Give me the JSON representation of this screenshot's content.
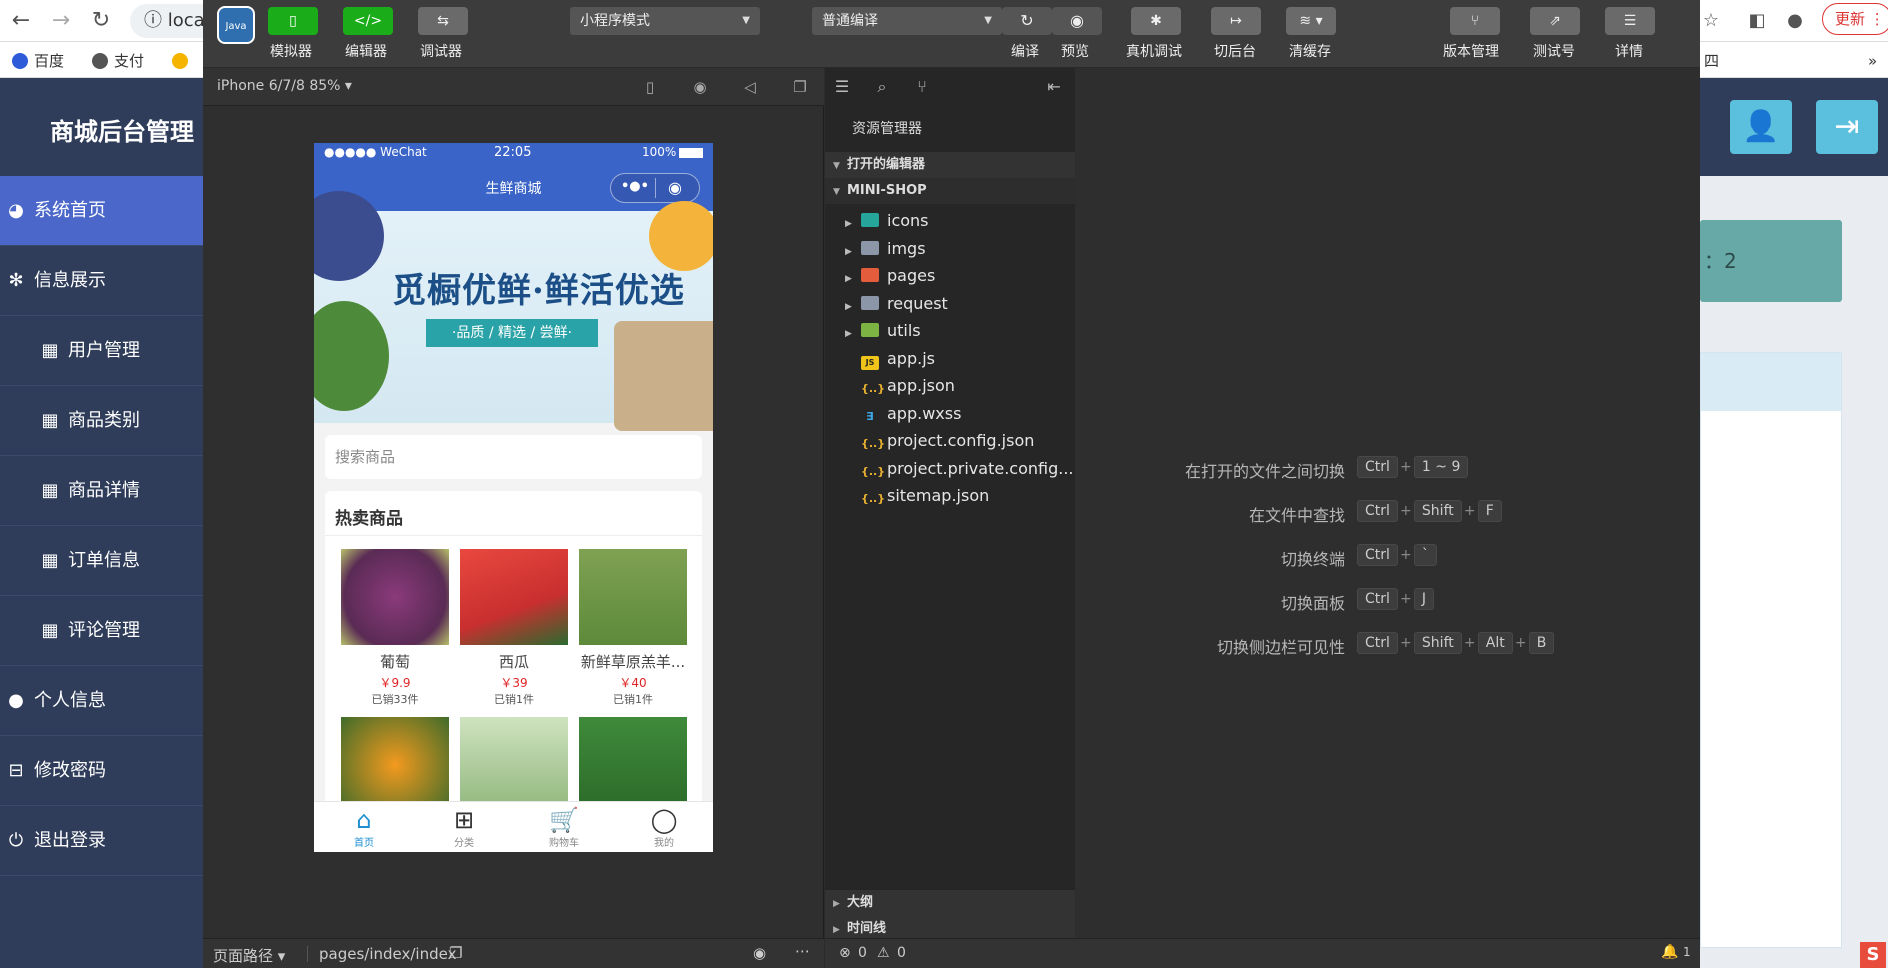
{
  "browser": {
    "address": "loca",
    "bookmarks": [
      "百度",
      "支付"
    ],
    "bookmark_tail": "四网",
    "update_label": "更新"
  },
  "admin": {
    "title": "商城后台管理",
    "menu": [
      {
        "label": "系统首页",
        "icon": "dashboard-icon",
        "active": true
      },
      {
        "label": "信息展示",
        "icon": "info-icon"
      },
      {
        "label": "用户管理",
        "icon": "table-icon",
        "sub": true
      },
      {
        "label": "商品类别",
        "icon": "table-icon",
        "sub": true
      },
      {
        "label": "商品详情",
        "icon": "table-icon",
        "sub": true
      },
      {
        "label": "订单信息",
        "icon": "table-icon",
        "sub": true
      },
      {
        "label": "评论管理",
        "icon": "table-icon",
        "sub": true
      },
      {
        "label": "个人信息",
        "icon": "user-icon"
      },
      {
        "label": "修改密码",
        "icon": "lock-icon"
      },
      {
        "label": "退出登录",
        "icon": "power-icon"
      }
    ],
    "stat_text": "：2"
  },
  "toolbar": {
    "simulator": "模拟器",
    "editor": "编辑器",
    "debugger": "调试器",
    "mode_select": "小程序模式",
    "compile_select": "普通编译",
    "compile": "编译",
    "preview": "预览",
    "remote_debug": "真机调试",
    "background": "切后台",
    "clear_cache": "清缓存",
    "version": "版本管理",
    "test_account": "测试号",
    "details": "详情",
    "accent_green": "#1aad19"
  },
  "simulator": {
    "device": "iPhone 6/7/8 85%",
    "status_left": "●●●●● WeChat",
    "status_time": "22:05",
    "status_battery": "100%",
    "nav_title": "生鲜商城",
    "banner_title": "觅橱优鲜·鲜活优选",
    "banner_ribbon": "·品质 / 精选 / 尝鲜·",
    "search_placeholder": "搜索商品",
    "hot_title": "热卖商品",
    "products": [
      {
        "name": "葡萄",
        "price": "￥9.9",
        "sold": "已销33件"
      },
      {
        "name": "西瓜",
        "price": "￥39",
        "sold": "已销1件"
      },
      {
        "name": "新鲜草原羔羊...",
        "price": "￥40",
        "sold": "已销1件"
      }
    ],
    "tabs": [
      {
        "label": "首页",
        "icon": "home-icon",
        "active": true
      },
      {
        "label": "分类",
        "icon": "grid-icon"
      },
      {
        "label": "购物车",
        "icon": "cart-icon"
      },
      {
        "label": "我的",
        "icon": "person-icon"
      }
    ],
    "page_path_label": "页面路径",
    "page_path": "pages/index/index"
  },
  "explorer": {
    "heading": "资源管理器",
    "open_editors": "打开的编辑器",
    "project": "MINI-SHOP",
    "items": [
      {
        "name": "icons",
        "type": "folder"
      },
      {
        "name": "imgs",
        "type": "folder"
      },
      {
        "name": "pages",
        "type": "folder"
      },
      {
        "name": "request",
        "type": "folder"
      },
      {
        "name": "utils",
        "type": "folder"
      },
      {
        "name": "app.js",
        "type": "js"
      },
      {
        "name": "app.json",
        "type": "json"
      },
      {
        "name": "app.wxss",
        "type": "css"
      },
      {
        "name": "project.config.json",
        "type": "json"
      },
      {
        "name": "project.private.config...",
        "type": "json"
      },
      {
        "name": "sitemap.json",
        "type": "json"
      }
    ],
    "outline": "大纲",
    "timeline": "时间线",
    "errors": "0",
    "warnings": "0"
  },
  "editor": {
    "shortcuts": [
      {
        "label": "在打开的文件之间切换",
        "keys": [
          "Ctrl",
          "1 ~ 9"
        ]
      },
      {
        "label": "在文件中查找",
        "keys": [
          "Ctrl",
          "Shift",
          "F"
        ]
      },
      {
        "label": "切换终端",
        "keys": [
          "Ctrl",
          "`"
        ]
      },
      {
        "label": "切换面板",
        "keys": [
          "Ctrl",
          "J"
        ]
      },
      {
        "label": "切换侧边栏可见性",
        "keys": [
          "Ctrl",
          "Shift",
          "Alt",
          "B"
        ]
      }
    ],
    "notifications": "1"
  }
}
